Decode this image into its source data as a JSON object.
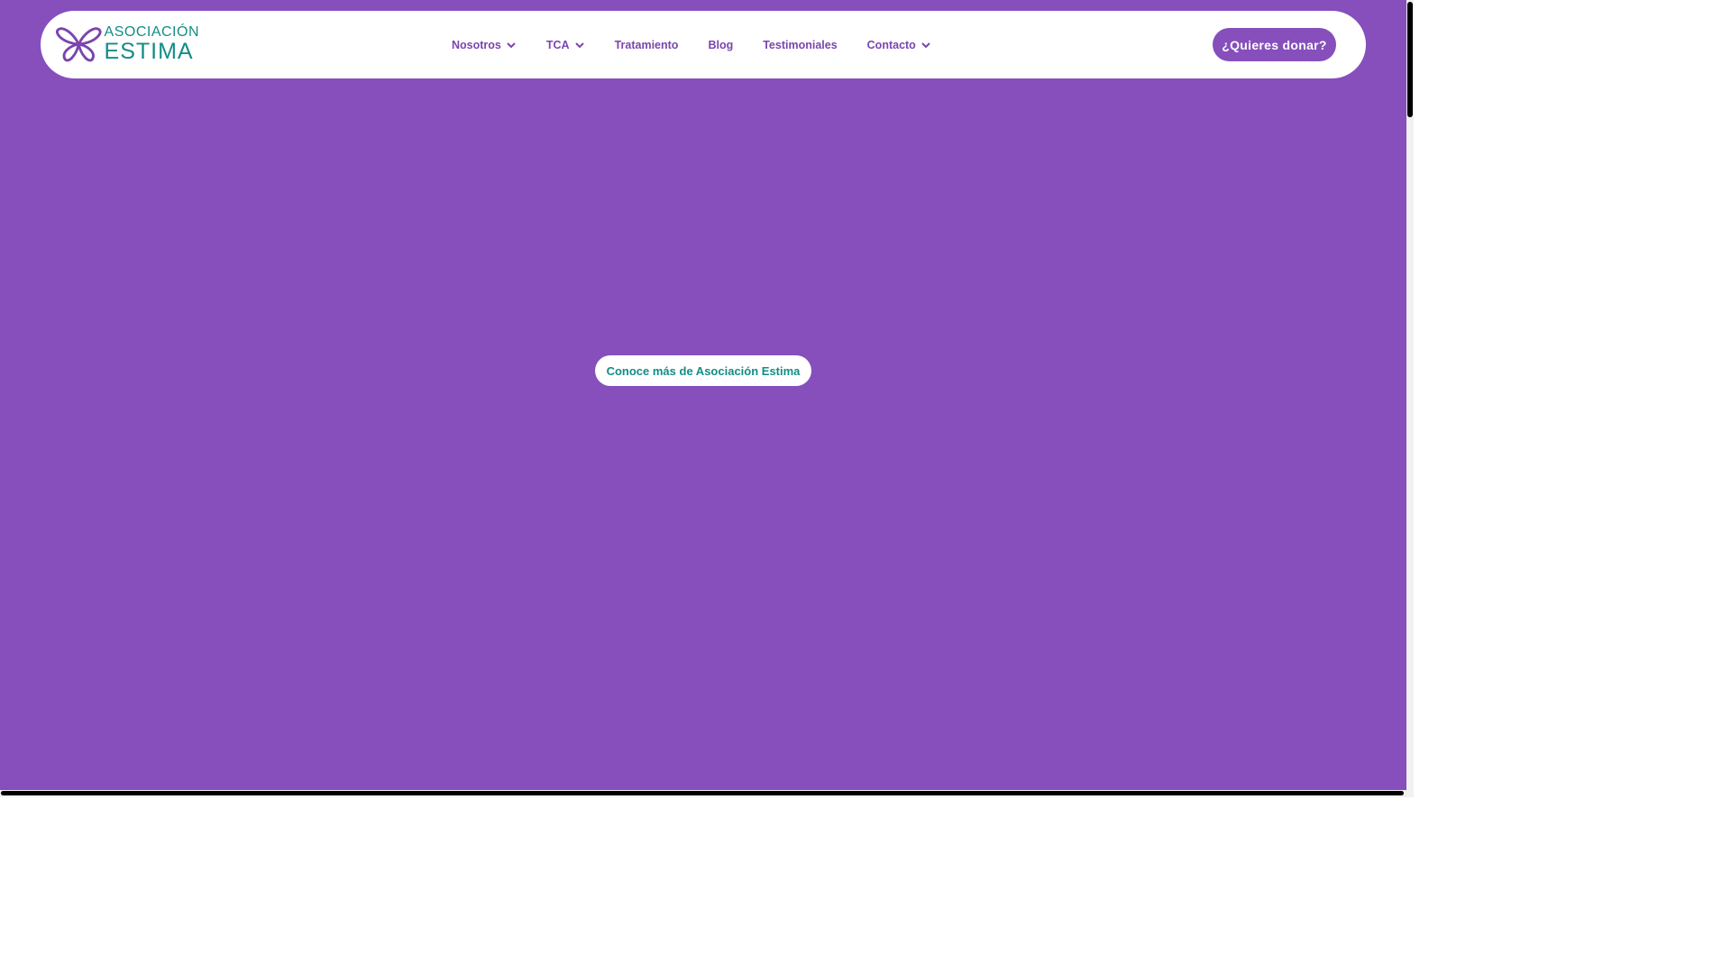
{
  "header": {
    "logo": {
      "line1": "ASOCIACIÓN",
      "line2": "ESTIMA",
      "icon": "butterfly-logo-icon"
    },
    "nav": [
      {
        "label": "Nosotros",
        "has_dropdown": true
      },
      {
        "label": "TCA",
        "has_dropdown": true
      },
      {
        "label": "Tratamiento",
        "has_dropdown": false
      },
      {
        "label": "Blog",
        "has_dropdown": false
      },
      {
        "label": "Testimoniales",
        "has_dropdown": false
      },
      {
        "label": "Contacto",
        "has_dropdown": true
      }
    ],
    "donate_label": "¿Quieres donar?"
  },
  "hero": {
    "cta_label": "Conoce más de Asociación Estima"
  },
  "colors": {
    "background": "#864fbc",
    "brand_purple": "#7a45ae",
    "brand_teal": "#138d85",
    "white": "#ffffff"
  }
}
